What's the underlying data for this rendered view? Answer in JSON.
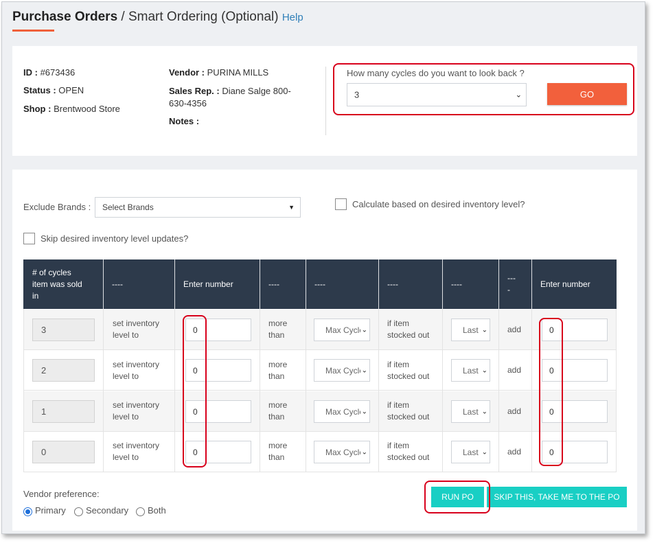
{
  "header": {
    "title_main": "Purchase Orders",
    "separator": "/",
    "title_sub": "Smart Ordering (Optional)",
    "help_link": "Help",
    "accent_color": "#f0603a"
  },
  "order": {
    "id_label": "ID :",
    "id_value": "#673436",
    "status_label": "Status :",
    "status_value": "OPEN",
    "shop_label": "Shop :",
    "shop_value": "Brentwood Store",
    "vendor_label": "Vendor :",
    "vendor_value": "PURINA MILLS",
    "salesrep_label": "Sales Rep. :",
    "salesrep_value_line1": "Diane Salge 800-",
    "salesrep_value_line2": "630-4356",
    "notes_label": "Notes :"
  },
  "lookback": {
    "question": "How many cycles do you want to look back ?",
    "selected": "3",
    "go_label": "GO",
    "go_color": "#f2603c"
  },
  "filters": {
    "exclude_brands_label": "Exclude Brands :",
    "brands_placeholder": "Select Brands",
    "calc_desired_label": "Calculate based on desired inventory level?",
    "skip_desired_label": "Skip desired inventory level updates?"
  },
  "table": {
    "header_color": "#2d3a4b",
    "headers": {
      "cycles_line1": "# of cycles",
      "cycles_line2": "item was sold",
      "cycles_line3": "in",
      "c2": "----",
      "c3": "Enter number",
      "c4": "----",
      "c5": "----",
      "c6": "----",
      "c7": "----",
      "c8_line1": "---",
      "c8_line2": "-",
      "c9": "Enter number"
    },
    "rows": [
      {
        "cycles": "3",
        "action_line1": "set inventory",
        "action_line2": "level to",
        "level": "0",
        "cmp_line1": "more",
        "cmp_line2": "than",
        "cycle_select": "Max Cycle",
        "cond_line1": "if item",
        "cond_line2": "stocked out",
        "last_select": "Last",
        "add": "add",
        "add_value": "0"
      },
      {
        "cycles": "2",
        "action_line1": "set inventory",
        "action_line2": "level to",
        "level": "0",
        "cmp_line1": "more",
        "cmp_line2": "than",
        "cycle_select": "Max Cycle",
        "cond_line1": "if item",
        "cond_line2": "stocked out",
        "last_select": "Last",
        "add": "add",
        "add_value": "0"
      },
      {
        "cycles": "1",
        "action_line1": "set inventory",
        "action_line2": "level to",
        "level": "0",
        "cmp_line1": "more",
        "cmp_line2": "than",
        "cycle_select": "Max Cycle",
        "cond_line1": "if item",
        "cond_line2": "stocked out",
        "last_select": "Last",
        "add": "add",
        "add_value": "0"
      },
      {
        "cycles": "0",
        "action_line1": "set inventory",
        "action_line2": "level to",
        "level": "0",
        "cmp_line1": "more",
        "cmp_line2": "than",
        "cycle_select": "Max Cycle",
        "cond_line1": "if item",
        "cond_line2": "stocked out",
        "last_select": "Last",
        "add": "add",
        "add_value": "0"
      }
    ]
  },
  "vendor_pref": {
    "label": "Vendor preference:",
    "options": [
      "Primary",
      "Secondary",
      "Both"
    ],
    "selected": "Primary"
  },
  "actions": {
    "run_po": "RUN PO",
    "skip": "SKIP THIS, TAKE ME TO THE PO",
    "button_color": "#19cfc4"
  },
  "highlight_color": "#d8001b"
}
